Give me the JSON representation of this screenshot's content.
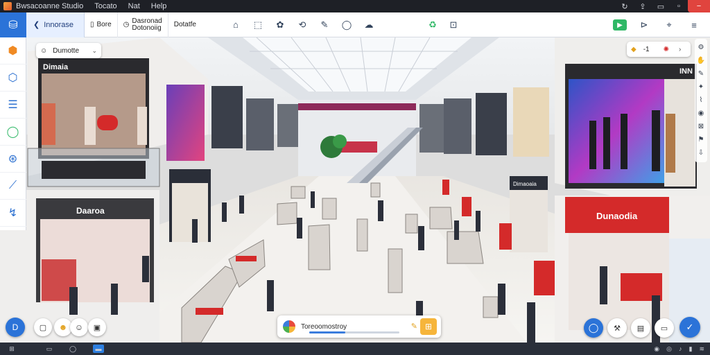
{
  "menubar": {
    "items": [
      "Bwsacoanne Studio",
      "Tocato",
      "Nat",
      "Help"
    ]
  },
  "toolbar": {
    "home_icon": "map-marker-icon",
    "back_label": "Innorase",
    "btn_store": "Bore",
    "btn_dashboard_line1": "Dasronad",
    "btn_dashboard_line2": "Dotonoiig",
    "btn_donate": "Dotatfe"
  },
  "location_chip": {
    "label": "Dumotte"
  },
  "counter_chip": {
    "value": "-1"
  },
  "search_panel": {
    "label": "Toreoomostroy",
    "progress": 0.4
  },
  "scene": {
    "signs": [
      "Dimaia",
      "Daaroa",
      "Dimaoaia",
      "Dunaodia",
      "INN"
    ]
  },
  "colors": {
    "accent": "#2b73d8",
    "brand_red": "#d42a2a",
    "warning": "#f6b53b",
    "success": "#2fb866"
  }
}
